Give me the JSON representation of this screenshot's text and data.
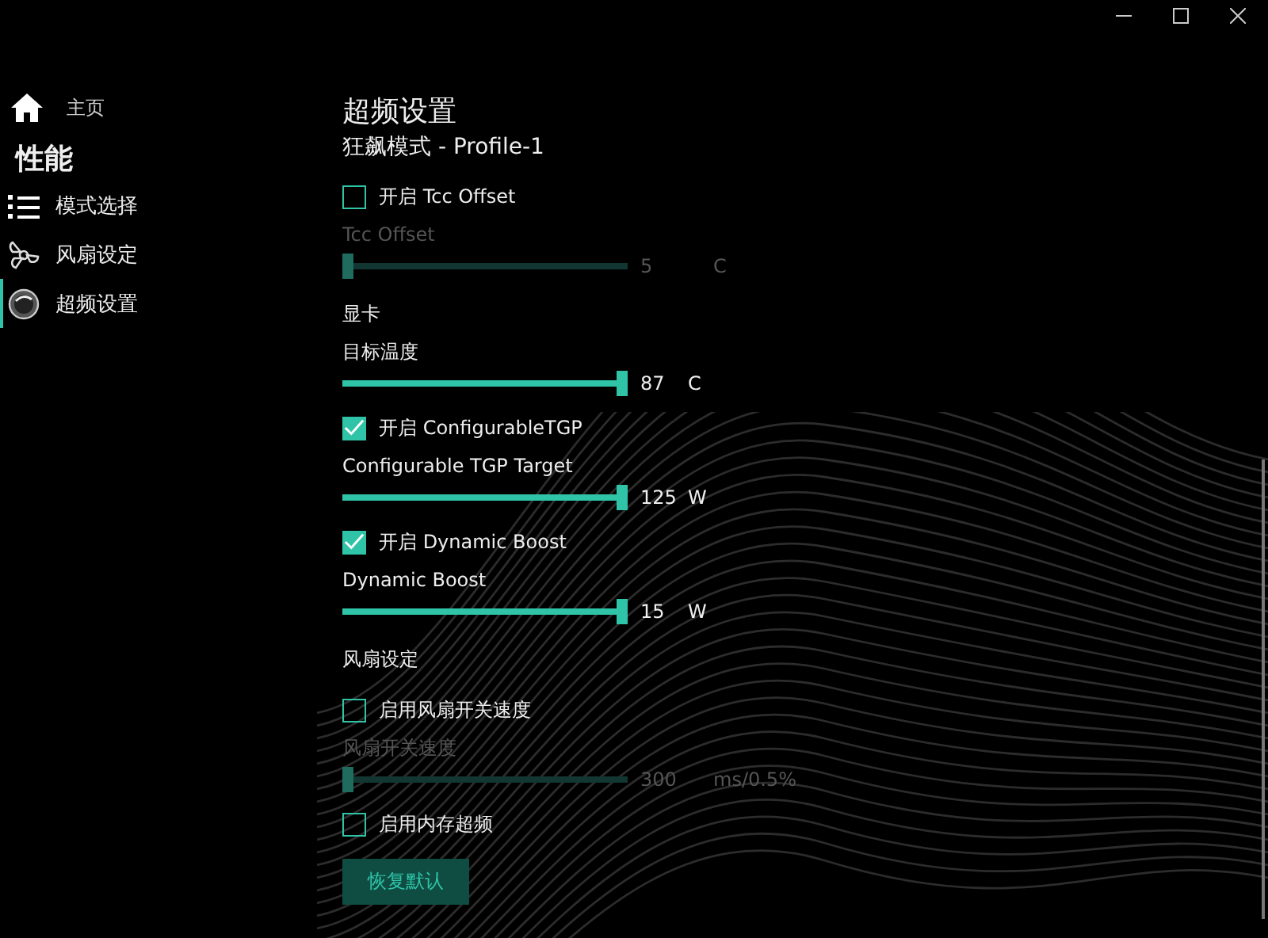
{
  "nav": {
    "home": "主页",
    "section": "性能",
    "items": [
      {
        "label": "模式选择",
        "selected": false
      },
      {
        "label": "风扇设定",
        "selected": false
      },
      {
        "label": "超频设置",
        "selected": true
      }
    ]
  },
  "title": "超频设置",
  "subtitle": "狂飙模式 - Profile-1",
  "settings": [
    {
      "kind": "checkbox",
      "label": "开启 Tcc Offset",
      "checked": false
    },
    {
      "kind": "slider",
      "label": "Tcc Offset",
      "level": 0.0,
      "value": "5",
      "unit": "C",
      "disabled": true
    },
    {
      "kind": "section",
      "label": "显卡"
    },
    {
      "kind": "slider",
      "label": "目标温度",
      "level": 1.0,
      "value": "87",
      "unit": "C",
      "disabled": false
    },
    {
      "kind": "checkbox",
      "label": "开启 ConfigurableTGP",
      "checked": true
    },
    {
      "kind": "slider",
      "label": "Configurable TGP Target",
      "level": 1.0,
      "value": "125",
      "unit": "W",
      "disabled": false
    },
    {
      "kind": "checkbox",
      "label": "开启 Dynamic Boost",
      "checked": true
    },
    {
      "kind": "slider",
      "label": "Dynamic Boost",
      "level": 1.0,
      "value": "15",
      "unit": "W",
      "disabled": false
    },
    {
      "kind": "section",
      "label": "风扇设定"
    },
    {
      "kind": "checkbox",
      "label": "启用风扇开关速度",
      "checked": false
    },
    {
      "kind": "slider",
      "label": "风扇开关速度",
      "level": 0.0,
      "value": "300",
      "unit": "ms/0.5%",
      "disabled": true
    },
    {
      "kind": "checkbox",
      "label": "启用内存超频",
      "checked": false
    },
    {
      "kind": "button",
      "label": "恢复默认"
    }
  ]
}
